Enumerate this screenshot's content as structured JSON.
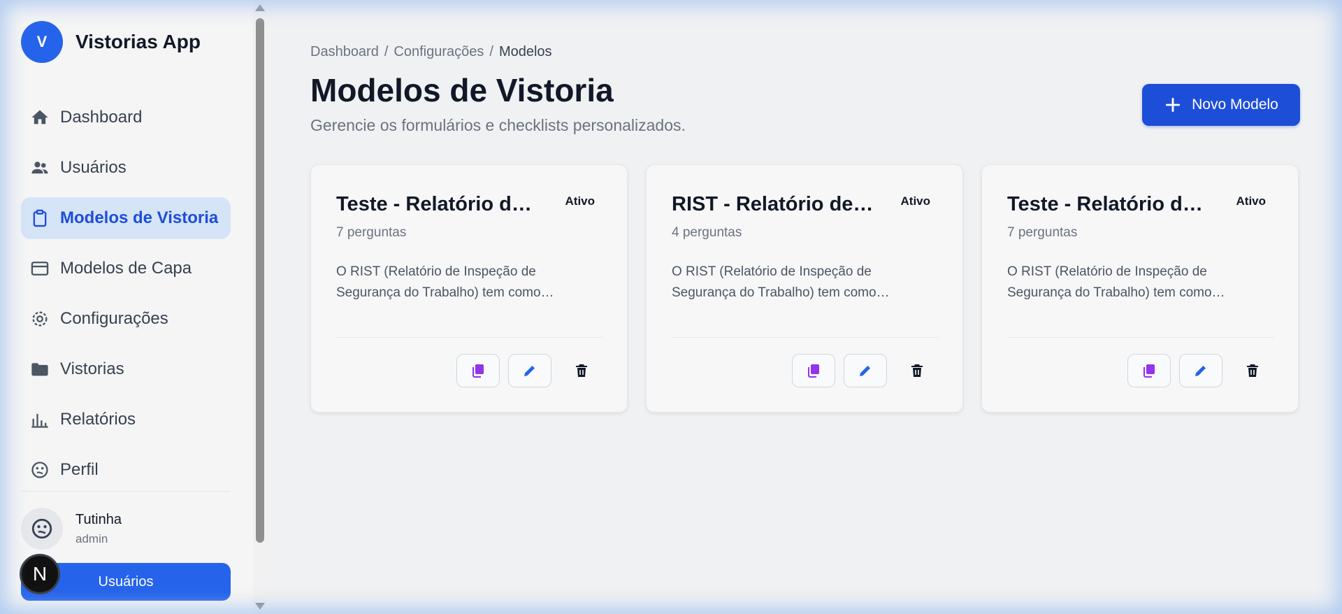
{
  "app": {
    "title": "Vistorias App",
    "logo_letter": "V"
  },
  "sidebar": {
    "items": [
      {
        "label": "Dashboard",
        "icon": "home-icon",
        "active": false
      },
      {
        "label": "Usuários",
        "icon": "users-icon",
        "active": false
      },
      {
        "label": "Modelos de Vistoria",
        "icon": "clipboard-icon",
        "active": true
      },
      {
        "label": "Modelos de Capa",
        "icon": "card-icon",
        "active": false
      },
      {
        "label": "Configurações",
        "icon": "gear-icon",
        "active": false
      },
      {
        "label": "Vistorias",
        "icon": "folder-icon",
        "active": false
      },
      {
        "label": "Relatórios",
        "icon": "bar-chart-icon",
        "active": false
      },
      {
        "label": "Perfil",
        "icon": "face-icon",
        "active": false
      }
    ],
    "user": {
      "name": "Tutinha",
      "role": "admin"
    },
    "bottom_button": "Usuários",
    "badge_letter": "N"
  },
  "breadcrumb": {
    "items": [
      "Dashboard",
      "Configurações",
      "Modelos"
    ],
    "separator": "/"
  },
  "header": {
    "title": "Modelos de Vistoria",
    "subtitle": "Gerencie os formulários e checklists personalizados.",
    "new_button": "Novo Modelo"
  },
  "cards": [
    {
      "title": "Teste - Relatório de…",
      "status": "Ativo",
      "count": "7 perguntas",
      "description": "O RIST (Relatório de Inspeção de Segurança do Trabalho) tem como…"
    },
    {
      "title": "RIST - Relatório de…",
      "status": "Ativo",
      "count": "4 perguntas",
      "description": "O RIST (Relatório de Inspeção de Segurança do Trabalho) tem como…"
    },
    {
      "title": "Teste - Relatório de…",
      "status": "Ativo",
      "count": "7 perguntas",
      "description": "O RIST (Relatório de Inspeção de Segurança do Trabalho) tem como…"
    }
  ],
  "colors": {
    "primary": "#2563eb",
    "primary_dark": "#1d4ed8",
    "active_bg": "#d6e4f7",
    "copy_icon": "#9333ea",
    "edit_icon": "#2563eb"
  }
}
